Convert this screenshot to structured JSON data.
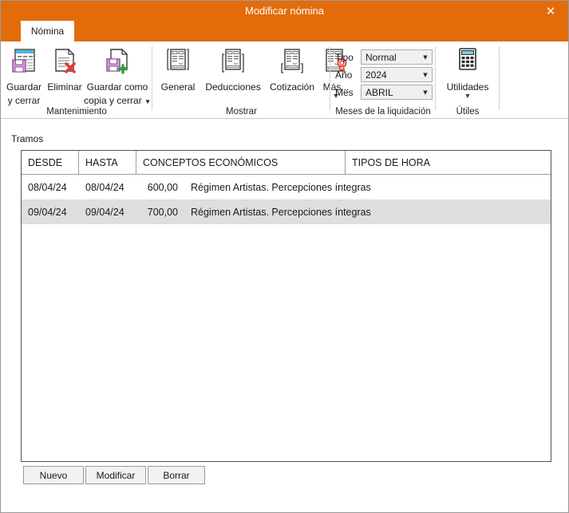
{
  "window": {
    "title": "Modificar nómina",
    "close_icon": "close-icon",
    "accent_color": "#e36c0a"
  },
  "tabs": [
    {
      "label": "Nómina",
      "active": true
    }
  ],
  "ribbon": {
    "groups": [
      {
        "name": "Mantenimiento",
        "label": "Mantenimiento",
        "buttons": [
          {
            "label_line1": "Guardar",
            "label_line2": "y cerrar",
            "icon": "save-and-close-icon",
            "caret": false
          },
          {
            "label_line1": "Eliminar",
            "label_line2": "",
            "icon": "delete-document-icon",
            "caret": false
          },
          {
            "label_line1": "Guardar como",
            "label_line2": "copia y cerrar",
            "icon": "save-copy-icon",
            "caret": true
          }
        ]
      },
      {
        "name": "Mostrar",
        "label": "Mostrar",
        "buttons": [
          {
            "label_line1": "General",
            "label_line2": "",
            "icon": "document-general-icon",
            "caret": false
          },
          {
            "label_line1": "Deducciones",
            "label_line2": "",
            "icon": "document-deductions-icon",
            "caret": false
          },
          {
            "label_line1": "Cotización",
            "label_line2": "",
            "icon": "document-contribution-icon",
            "caret": false
          },
          {
            "label_line1": "Más...",
            "label_line2": "",
            "icon": "document-seal-icon",
            "caret": true
          }
        ]
      },
      {
        "name": "Meses de la liquidación",
        "label": "Meses de la liquidación",
        "fields": [
          {
            "label": "Tipo",
            "value": "Normal"
          },
          {
            "label": "Año",
            "value": "2024"
          },
          {
            "label": "Mes",
            "value": "ABRIL"
          }
        ]
      },
      {
        "name": "Útiles",
        "label": "Útiles",
        "buttons": [
          {
            "label_line1": "Utilidades",
            "label_line2": "",
            "icon": "calculator-icon",
            "caret": true
          }
        ]
      }
    ]
  },
  "main": {
    "section_label": "Tramos",
    "grid": {
      "columns": [
        "DESDE",
        "HASTA",
        "CONCEPTOS ECONÓMICOS",
        "TIPOS DE HORA"
      ],
      "rows": [
        {
          "desde": "08/04/24",
          "hasta": "08/04/24",
          "importe": "600,00",
          "concepto": "Régimen Artistas. Percepciones íntegras",
          "tipos_de_hora": "",
          "selected": false
        },
        {
          "desde": "09/04/24",
          "hasta": "09/04/24",
          "importe": "700,00",
          "concepto": "Régimen Artistas. Percepciones íntegras",
          "tipos_de_hora": "",
          "selected": true
        }
      ]
    },
    "buttons": [
      {
        "label": "Nuevo"
      },
      {
        "label": "Modificar"
      },
      {
        "label": "Borrar"
      }
    ]
  }
}
